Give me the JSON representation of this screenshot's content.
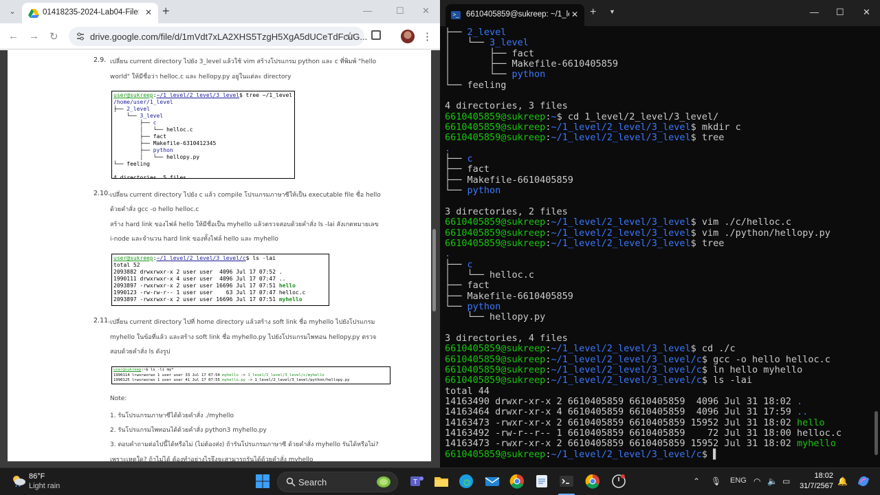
{
  "browser": {
    "tab_title": "01418235-2024-Lab04-FileSyste",
    "url": "drive.google.com/file/d/1mVdt7xLA2XHS5TzgH5XgA5dUCeTdFcuG..."
  },
  "doc": {
    "s29_num": "2.9.",
    "s29_l1": "เปลี่ยน current directory ไปยัง 3_level แล้วใช้ vim สร้างโปรแกรม python และ c ที่พิมพ์ \"hello",
    "s29_l2": "world\" ให้มีชื่อว่า helloc.c และ hellopy.py อยู่ในแต่ละ directory",
    "tree_shot": [
      [
        {
          "t": "user@sukreep",
          "c": "u1"
        },
        {
          "t": ":"
        },
        {
          "t": "~/1_level/2_level/3_level",
          "c": "p1"
        },
        {
          "t": "$ tree ~/1_level"
        }
      ],
      [
        {
          "t": "/home/user/1_level",
          "c": "p2"
        }
      ],
      [
        {
          "t": "├── "
        },
        {
          "t": "2_level",
          "c": "p2"
        }
      ],
      [
        {
          "t": "    └── "
        },
        {
          "t": "3_level",
          "c": "p2"
        }
      ],
      [
        {
          "t": "        ├── "
        },
        {
          "t": "c",
          "c": "p2"
        }
      ],
      [
        {
          "t": "        │   └── helloc.c"
        }
      ],
      [
        {
          "t": "        ├── fact"
        }
      ],
      [
        {
          "t": "        ├── Makefile-6310412345"
        }
      ],
      [
        {
          "t": "        ├── "
        },
        {
          "t": "python",
          "c": "p2"
        }
      ],
      [
        {
          "t": "        │   └── hellopy.py"
        }
      ],
      [
        {
          "t": "└── feeling"
        }
      ],
      [
        {
          "t": ""
        }
      ],
      [
        {
          "t": "4 directories, 5 files"
        }
      ]
    ],
    "s210_num": "2.10.",
    "s210_l1": "เปลี่ยน current directory ไปยัง c แล้ว compile โปรแกรมภาษาซีให้เป็น executable file ชื่อ hello",
    "s210_l2": "ด้วยคำสั่ง gcc -o hello helloc.c",
    "s210_l3": "สร้าง hard link ของไฟล์ hello ให้มีชื่อเป็น myhello แล้วตรวจสอบด้วยคำสั่ง ls -lai สังเกตหมายเลข",
    "s210_l4": "i-node และจำนวน hard link ของทั้งไฟล์ hello และ myhello",
    "ls_shot": [
      [
        {
          "t": "user@sukreep",
          "c": "u1"
        },
        {
          "t": ":"
        },
        {
          "t": "~/1_level/2_level/3_level/c",
          "c": "p1"
        },
        {
          "t": "$ ls -lai"
        }
      ],
      [
        {
          "t": "total 52"
        }
      ],
      [
        {
          "t": "2093882 drwxrwxr-x 2 user user  4096 Jul 17 07:52 ."
        }
      ],
      [
        {
          "t": "1990111 drwxrwxr-x 4 user user  4096 Jul 17 07:47 .."
        }
      ],
      [
        {
          "t": "2093897 -rwxrwxr-x 2 user user 16696 Jul 17 07:51 "
        },
        {
          "t": "hello",
          "c": "grb"
        }
      ],
      [
        {
          "t": "1990123 -rw-rw-r-- 1 user user    63 Jul 17 07:47 helloc.c"
        }
      ],
      [
        {
          "t": "2093897 -rwxrwxr-x 2 user user 16696 Jul 17 07:51 "
        },
        {
          "t": "myhello",
          "c": "grb"
        }
      ]
    ],
    "s211_num": "2.11.",
    "s211_l1": "เปลี่ยน current directory ไปที่ home directory แล้วสร้าง soft link ชื่อ myhello ไปยังโปรแกรม",
    "s211_l2": "myhello ในข้อที่แล้ว และสร้าง soft link ชื่อ myhello.py ไปยังโปรแกรมไพทอน hellopy.py ตรวจ",
    "s211_l3": "สอบด้วยคำสั่ง ls ดังรูป",
    "sl_shot": [
      [
        {
          "t": "user@sukreep",
          "c": "u1"
        },
        {
          "t": ":~$ ls -li my*"
        }
      ],
      [
        {
          "t": "1990114 lrwxrwxrwx 1 user user 33 Jul 17 07:54 "
        },
        {
          "t": "myhello",
          "c": "gr"
        },
        {
          "t": " -> "
        },
        {
          "t": "1_level/2_level/3_level/c/myhello",
          "c": "gr"
        }
      ],
      [
        {
          "t": "1990125 lrwxrwxrwx 1 user user 41 Jul 17 07:55 "
        },
        {
          "t": "myhello.py",
          "c": "gr"
        },
        {
          "t": " -> 1_level/2_level/3_level/python/hellopy.py"
        }
      ]
    ],
    "note": "Note:",
    "n1": "1. รันโปรแกรมภาษาซีได้ด้วยคำสั่ง ./myhello",
    "n2": "2. รันโปรแกรมไพทอนได้ด้วยคำสั่ง python3 myhello.py",
    "n3": "3. ตอบคำถามต่อไปนี้ได้หรือไม่ (ไม่ต้องส่ง) ถ้ารันโปรแกรมภาษาซี ด้วยคำสั่ง myhello รันได้หรือไม่?",
    "n4": "เพราะเหตุใด? ถ้าไม่ได้ ต้องทำอย่างไรจึงจะสามารถรันได้ด้วยคำสั่ง myhello"
  },
  "terminal": {
    "tab_title": "6610405859@sukreep: ~/1_lev",
    "lines": [
      [
        {
          "t": "├── "
        },
        {
          "t": "2_level",
          "c": "b"
        }
      ],
      [
        {
          "t": "│   └── "
        },
        {
          "t": "3_level",
          "c": "b"
        }
      ],
      [
        {
          "t": "│       ├── fact"
        }
      ],
      [
        {
          "t": "│       ├── Makefile-6610405859"
        }
      ],
      [
        {
          "t": "│       └── "
        },
        {
          "t": "python",
          "c": "b"
        }
      ],
      [
        {
          "t": "└── feeling"
        }
      ],
      [
        {
          "t": ""
        }
      ],
      [
        {
          "t": "4 directories, 3 files"
        }
      ],
      [
        {
          "t": "6610405859@sukreep",
          "c": "g"
        },
        {
          "t": ":"
        },
        {
          "t": "~",
          "c": "b"
        },
        {
          "t": "$ cd 1_level/2_level/3_level/"
        }
      ],
      [
        {
          "t": "6610405859@sukreep",
          "c": "g"
        },
        {
          "t": ":"
        },
        {
          "t": "~/1_level/2_level/3_level",
          "c": "b"
        },
        {
          "t": "$ mkdir c"
        }
      ],
      [
        {
          "t": "6610405859@sukreep",
          "c": "g"
        },
        {
          "t": ":"
        },
        {
          "t": "~/1_level/2_level/3_level",
          "c": "b"
        },
        {
          "t": "$ tree"
        }
      ],
      [
        {
          "t": ".",
          "c": "b"
        }
      ],
      [
        {
          "t": "├── "
        },
        {
          "t": "c",
          "c": "b"
        }
      ],
      [
        {
          "t": "├── fact"
        }
      ],
      [
        {
          "t": "├── Makefile-6610405859"
        }
      ],
      [
        {
          "t": "└── "
        },
        {
          "t": "python",
          "c": "b"
        }
      ],
      [
        {
          "t": ""
        }
      ],
      [
        {
          "t": "3 directories, 2 files"
        }
      ],
      [
        {
          "t": "6610405859@sukreep",
          "c": "g"
        },
        {
          "t": ":"
        },
        {
          "t": "~/1_level/2_level/3_level",
          "c": "b"
        },
        {
          "t": "$ vim ./c/helloc.c"
        }
      ],
      [
        {
          "t": "6610405859@sukreep",
          "c": "g"
        },
        {
          "t": ":"
        },
        {
          "t": "~/1_level/2_level/3_level",
          "c": "b"
        },
        {
          "t": "$ vim ./python/hellopy.py"
        }
      ],
      [
        {
          "t": "6610405859@sukreep",
          "c": "g"
        },
        {
          "t": ":"
        },
        {
          "t": "~/1_level/2_level/3_level",
          "c": "b"
        },
        {
          "t": "$ tree"
        }
      ],
      [
        {
          "t": ".",
          "c": "b"
        }
      ],
      [
        {
          "t": "├── "
        },
        {
          "t": "c",
          "c": "b"
        }
      ],
      [
        {
          "t": "│   └── helloc.c"
        }
      ],
      [
        {
          "t": "├── fact"
        }
      ],
      [
        {
          "t": "├── Makefile-6610405859"
        }
      ],
      [
        {
          "t": "└── "
        },
        {
          "t": "python",
          "c": "b"
        }
      ],
      [
        {
          "t": "    └── hellopy.py"
        }
      ],
      [
        {
          "t": ""
        }
      ],
      [
        {
          "t": "3 directories, 4 files"
        }
      ],
      [
        {
          "t": "6610405859@sukreep",
          "c": "g"
        },
        {
          "t": ":"
        },
        {
          "t": "~/1_level/2_level/3_level",
          "c": "b"
        },
        {
          "t": "$ cd ./c"
        }
      ],
      [
        {
          "t": "6610405859@sukreep",
          "c": "g"
        },
        {
          "t": ":"
        },
        {
          "t": "~/1_level/2_level/3_level/c",
          "c": "b"
        },
        {
          "t": "$ gcc -o hello helloc.c"
        }
      ],
      [
        {
          "t": "6610405859@sukreep",
          "c": "g"
        },
        {
          "t": ":"
        },
        {
          "t": "~/1_level/2_level/3_level/c",
          "c": "b"
        },
        {
          "t": "$ ln hello myhello"
        }
      ],
      [
        {
          "t": "6610405859@sukreep",
          "c": "g"
        },
        {
          "t": ":"
        },
        {
          "t": "~/1_level/2_level/3_level/c",
          "c": "b"
        },
        {
          "t": "$ ls -lai"
        }
      ],
      [
        {
          "t": "total 44"
        }
      ],
      [
        {
          "t": "14163490 drwxr-xr-x 2 6610405859 6610405859  4096 Jul 31 18:02 "
        },
        {
          "t": ".",
          "c": "b"
        }
      ],
      [
        {
          "t": "14163464 drwxr-xr-x 4 6610405859 6610405859  4096 Jul 31 17:59 "
        },
        {
          "t": "..",
          "c": "b"
        }
      ],
      [
        {
          "t": "14163473 -rwxr-xr-x 2 6610405859 6610405859 15952 Jul 31 18:02 "
        },
        {
          "t": "hello",
          "c": "g"
        }
      ],
      [
        {
          "t": "14163492 -rw-r--r-- 1 6610405859 6610405859    72 Jul 31 18:00 helloc.c"
        }
      ],
      [
        {
          "t": "14163473 -rwxr-xr-x 2 6610405859 6610405859 15952 Jul 31 18:02 "
        },
        {
          "t": "myhello",
          "c": "g"
        }
      ],
      [
        {
          "t": "6610405859@sukreep",
          "c": "g"
        },
        {
          "t": ":"
        },
        {
          "t": "~/1_level/2_level/3_level/c",
          "c": "b"
        },
        {
          "t": "$ ▌"
        }
      ]
    ]
  },
  "taskbar": {
    "temp": "86°F",
    "weather": "Light rain",
    "search_label": "Search",
    "lang": "ENG",
    "time": "18:02",
    "date": "31/7/2567"
  },
  "colors": {
    "prompt_green": "#16c60c",
    "dir_blue": "#3b78ff",
    "terminal_bg": "#0c0c0c"
  },
  "icons": [
    "menu-icon",
    "drive-icon",
    "close-icon",
    "plus-icon",
    "back-icon",
    "forward-icon",
    "reload-icon",
    "site-info-icon",
    "star-icon",
    "extensions-icon",
    "kebab-icon",
    "powershell-icon",
    "chevron-down-icon",
    "weather-icon",
    "windows-start-icon",
    "search-icon",
    "copilot-icon",
    "teams-icon",
    "edge-icon",
    "mail-icon",
    "file-explorer-icon",
    "chrome-icon",
    "notepad-icon",
    "terminal-icon",
    "snipping-icon",
    "chevron-up-icon",
    "mic-icon",
    "wifi-icon",
    "speaker-icon",
    "battery-icon",
    "bell-icon",
    "copilot-tray-icon"
  ]
}
